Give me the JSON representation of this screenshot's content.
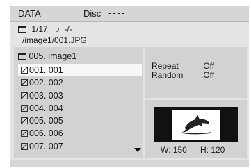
{
  "header": {
    "title": "DATA",
    "disc_label": "Disc",
    "disc_value": "----"
  },
  "track": {
    "number": "1/17",
    "music_value": "-/-",
    "path": "/image1/001.JPG"
  },
  "list": {
    "folder": "005. image1",
    "items": [
      "001. 001",
      "002. 002",
      "003. 003",
      "004. 004",
      "005. 005",
      "006. 006",
      "007. 007"
    ],
    "selected_index": 0
  },
  "settings": {
    "repeat_label": "Repeat",
    "repeat_value": ":Off",
    "random_label": "Random",
    "random_value": ":Off"
  },
  "preview": {
    "width_text": "W: 150",
    "height_text": "H: 120"
  },
  "icons": {
    "folder": "folder-icon",
    "music": "music-note-icon",
    "image": "image-file-icon",
    "scroll": "scroll-down-arrow-icon",
    "thumbnail": "dolphin-thumbnail"
  }
}
